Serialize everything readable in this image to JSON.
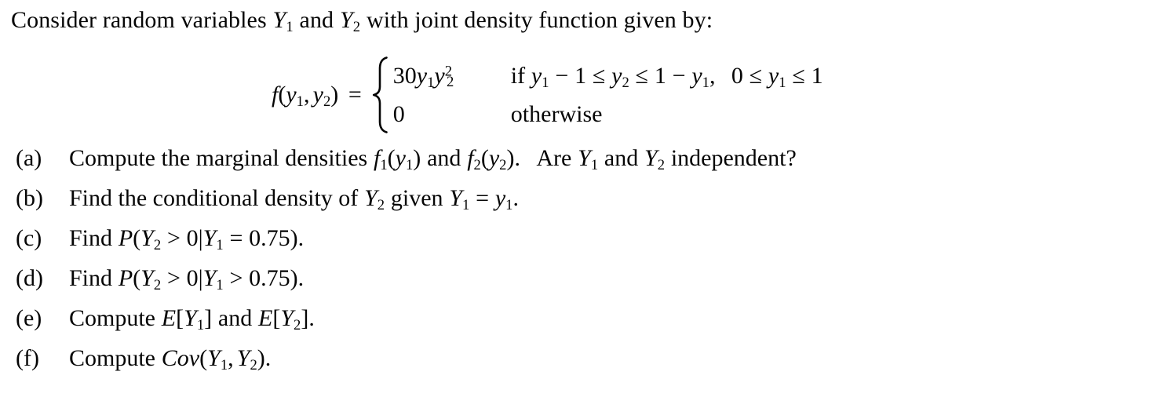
{
  "document": {
    "type": "math-problem",
    "background_color": "#ffffff",
    "text_color": "#050505",
    "intro": {
      "text_before_y1": "Consider random variables",
      "var1": "Y",
      "var1_sub": "1",
      "conjunction": "and",
      "var2": "Y",
      "var2_sub": "2",
      "text_after": "with joint density function given by:",
      "full_text": "Consider random variables Y1 and Y2 with joint density function given by:"
    },
    "equation": {
      "lhs_f": "f",
      "lhs_open": "(",
      "lhs_y": "y",
      "lhs_sub1": "1",
      "lhs_comma": ",",
      "lhs_y2": "y",
      "lhs_sub2": "2",
      "lhs_close": ")",
      "equals": "=",
      "brace": "{",
      "case1": {
        "value_coefficient": "30",
        "value_y1": "y",
        "value_y1_sub": "1",
        "value_y2": "y",
        "value_y2_sub": "2",
        "value_y2_sup": "2",
        "condition_if": "if",
        "cond_y1": "y",
        "cond_y1_sub": "1",
        "cond_minus": "−",
        "cond_one": "1",
        "cond_le1": "≤",
        "cond_y2": "y",
        "cond_y2_sub": "2",
        "cond_le2": "≤",
        "cond_one_b": "1",
        "cond_minus_b": "−",
        "cond_y1_b": "y",
        "cond_y1_b_sub": "1",
        "cond_comma": ",",
        "cond_zero": "0",
        "cond_le3": "≤",
        "cond_y1_c": "y",
        "cond_y1_c_sub": "1",
        "cond_le4": "≤",
        "cond_one_c": "1",
        "full_value_text": "30y1y2^2",
        "full_condition_text": "if y1 - 1 ≤ y2 ≤ 1 - y1,  0 ≤ y1 ≤ 1"
      },
      "case2": {
        "value": "0",
        "condition": "otherwise"
      }
    },
    "list": [
      {
        "label": "(a)",
        "full_text": "Compute the marginal densities f1(y1) and f2(y2). Are Y1 and Y2 independent?",
        "parts": {
          "lead": "Compute the marginal densities",
          "f1": "f",
          "f1_sub": "1",
          "f1_open": "(",
          "f1_y": "y",
          "f1_y_sub": "1",
          "f1_close": ")",
          "and1": "and",
          "f2": "f",
          "f2_sub": "2",
          "f2_open": "(",
          "f2_y": "y",
          "f2_y_sub": "2",
          "f2_close": ")",
          "period": ".",
          "mid": "Are",
          "Y1": "Y",
          "Y1_sub": "1",
          "and2": "and",
          "Y2": "Y",
          "Y2_sub": "2",
          "tail": "independent?"
        }
      },
      {
        "label": "(b)",
        "full_text": "Find the conditional density of Y2 given Y1 = y1.",
        "parts": {
          "lead": "Find the conditional density of",
          "Y2": "Y",
          "Y2_sub": "2",
          "given": "given",
          "Y1": "Y",
          "Y1_sub": "1",
          "equals": "=",
          "y1": "y",
          "y1_sub": "1",
          "period": "."
        }
      },
      {
        "label": "(c)",
        "full_text": "Find P(Y2 > 0|Y1 = 0.75).",
        "parts": {
          "lead": "Find",
          "P": "P",
          "open": "(",
          "Y2": "Y",
          "Y2_sub": "2",
          "gt": ">",
          "zero": "0",
          "bar": "|",
          "Y1": "Y",
          "Y1_sub": "1",
          "rel": "=",
          "value": "0.75",
          "close": ")",
          "period": "."
        }
      },
      {
        "label": "(d)",
        "full_text": "Find P(Y2 > 0|Y1 > 0.75).",
        "parts": {
          "lead": "Find",
          "P": "P",
          "open": "(",
          "Y2": "Y",
          "Y2_sub": "2",
          "gt": ">",
          "zero": "0",
          "bar": "|",
          "Y1": "Y",
          "Y1_sub": "1",
          "rel": ">",
          "value": "0.75",
          "close": ")",
          "period": "."
        }
      },
      {
        "label": "(e)",
        "full_text": "Compute E[Y1] and E[Y2].",
        "parts": {
          "lead": "Compute",
          "E1": "E",
          "ob1": "[",
          "Y1": "Y",
          "Y1_sub": "1",
          "cb1": "]",
          "and": "and",
          "E2": "E",
          "ob2": "[",
          "Y2": "Y",
          "Y2_sub": "2",
          "cb2": "]",
          "period": "."
        }
      },
      {
        "label": "(f)",
        "full_text": "Compute Cov(Y1, Y2).",
        "parts": {
          "lead": "Compute",
          "cov": "Cov",
          "open": "(",
          "Y1": "Y",
          "Y1_sub": "1",
          "comma": ",",
          "Y2": "Y",
          "Y2_sub": "2",
          "close": ")",
          "period": "."
        }
      }
    ]
  }
}
